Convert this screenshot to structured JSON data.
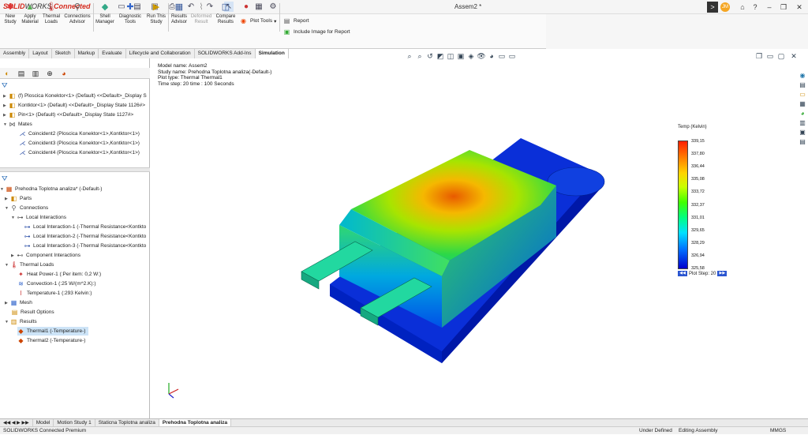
{
  "app": {
    "brand_solid": "SOLID",
    "brand_works": "WORKS",
    "brand_connected": "Connected",
    "doc_title": "Assem2 *"
  },
  "ribbon": {
    "buttons": [
      {
        "label": "New Study",
        "icon": "new-study-icon"
      },
      {
        "label": "Apply Material",
        "icon": "apply-material-icon"
      },
      {
        "label": "Thermal Loads",
        "icon": "thermal-loads-icon"
      },
      {
        "label": "Connections Advisor",
        "icon": "connections-icon"
      },
      {
        "label": "Shell Manager",
        "icon": "shell-manager-icon"
      },
      {
        "label": "Diagnostic Tools",
        "icon": "diagnostic-icon"
      },
      {
        "label": "Run This Study",
        "icon": "run-study-icon"
      },
      {
        "label": "Results Advisor",
        "icon": "results-advisor-icon"
      },
      {
        "label": "Deformed Result",
        "icon": "deformed-result-icon"
      },
      {
        "label": "Compare Results",
        "icon": "compare-results-icon"
      }
    ],
    "plot_tools": "Plot Tools",
    "report": "Report",
    "include_image": "Include Image for Report"
  },
  "command_tabs": [
    "Assembly",
    "Layout",
    "Sketch",
    "Markup",
    "Evaluate",
    "Lifecycle and Collaboration",
    "SOLIDWORKS Add-Ins",
    "Simulation"
  ],
  "active_tab": "Simulation",
  "feature_tree": [
    {
      "label": "(f) Ploscica Konektor<1> (Default) <<Default>_Display S",
      "icon": "part-icon"
    },
    {
      "label": "Kontktor<1> (Default) <<Default>_Display State 1126#>",
      "icon": "part-icon"
    },
    {
      "label": "Pin<1> (Default) <<Default>_Display State 1127#>",
      "icon": "part-icon"
    },
    {
      "label": "Mates",
      "icon": "mates-icon"
    },
    {
      "label": "Coincident2 (Ploscica Konektor<1>,Kontktor<1>)",
      "icon": "coincident-icon"
    },
    {
      "label": "Coincident3 (Ploscica Konektor<1>,Kontktor<1>)",
      "icon": "coincident-icon"
    },
    {
      "label": "Coincident4 (Ploscica Konektor<1>,Kontktor<1>)",
      "icon": "coincident-icon"
    }
  ],
  "study_tree": [
    {
      "label": "Prehodna Toplotna analiza* (-Default-)",
      "icon": "study-icon"
    },
    {
      "label": "Parts",
      "icon": "parts-icon"
    },
    {
      "label": "Connections",
      "icon": "connections-icon"
    },
    {
      "label": "Local Interactions",
      "icon": "local-interactions-icon"
    },
    {
      "label": "Local Interaction-1 (-Thermal Resistance<Kontkto",
      "icon": "interaction-icon"
    },
    {
      "label": "Local Interaction-2 (-Thermal Resistance<Kontkto",
      "icon": "interaction-icon"
    },
    {
      "label": "Local Interaction-3 (-Thermal Resistance<Kontkto",
      "icon": "interaction-icon"
    },
    {
      "label": "Component Interactions",
      "icon": "component-interactions-icon"
    },
    {
      "label": "Thermal Loads",
      "icon": "thermal-loads-icon"
    },
    {
      "label": "Heat Power-1 (:Per item: 0,2 W:)",
      "icon": "heat-power-icon"
    },
    {
      "label": "Convection-1 (:25 W/(m^2.K):)",
      "icon": "convection-icon"
    },
    {
      "label": "Temperature-1 (:293 Kelvin:)",
      "icon": "temperature-icon"
    },
    {
      "label": "Mesh",
      "icon": "mesh-icon"
    },
    {
      "label": "Result Options",
      "icon": "result-options-icon"
    },
    {
      "label": "Results",
      "icon": "results-icon"
    },
    {
      "label": "Thermal1 (-Temperature-)",
      "icon": "thermal-plot-icon"
    },
    {
      "label": "Thermal2 (-Temperature-)",
      "icon": "thermal-plot-icon"
    }
  ],
  "info": {
    "model": "Model name: Assem2",
    "study": "Study name: Prehodna Toplotna analiza(-Default-)",
    "plot_type": "Plot type: Thermal Thermal1",
    "time": "Time step: 20   time : 100 Seconds"
  },
  "legend": {
    "title": "Temp (Kelvin)",
    "ticks": [
      "339,15",
      "337,80",
      "336,44",
      "335,08",
      "333,72",
      "332,37",
      "331,01",
      "329,65",
      "328,29",
      "326,94",
      "325,58"
    ],
    "plot_step": "Plot Step: 20"
  },
  "bottom_tabs": [
    "Model",
    "Motion Study 1",
    "Staticna Toplotna analiza",
    "Prehodna Toplotna analiza"
  ],
  "active_bottom_tab": "Prehodna Toplotna analiza",
  "status": {
    "left": "SOLIDWORKS Connected Premium",
    "under_defined": "Under Defined",
    "editing": "Editing Assembly",
    "units": "MMGS"
  },
  "user_initials": "JM"
}
